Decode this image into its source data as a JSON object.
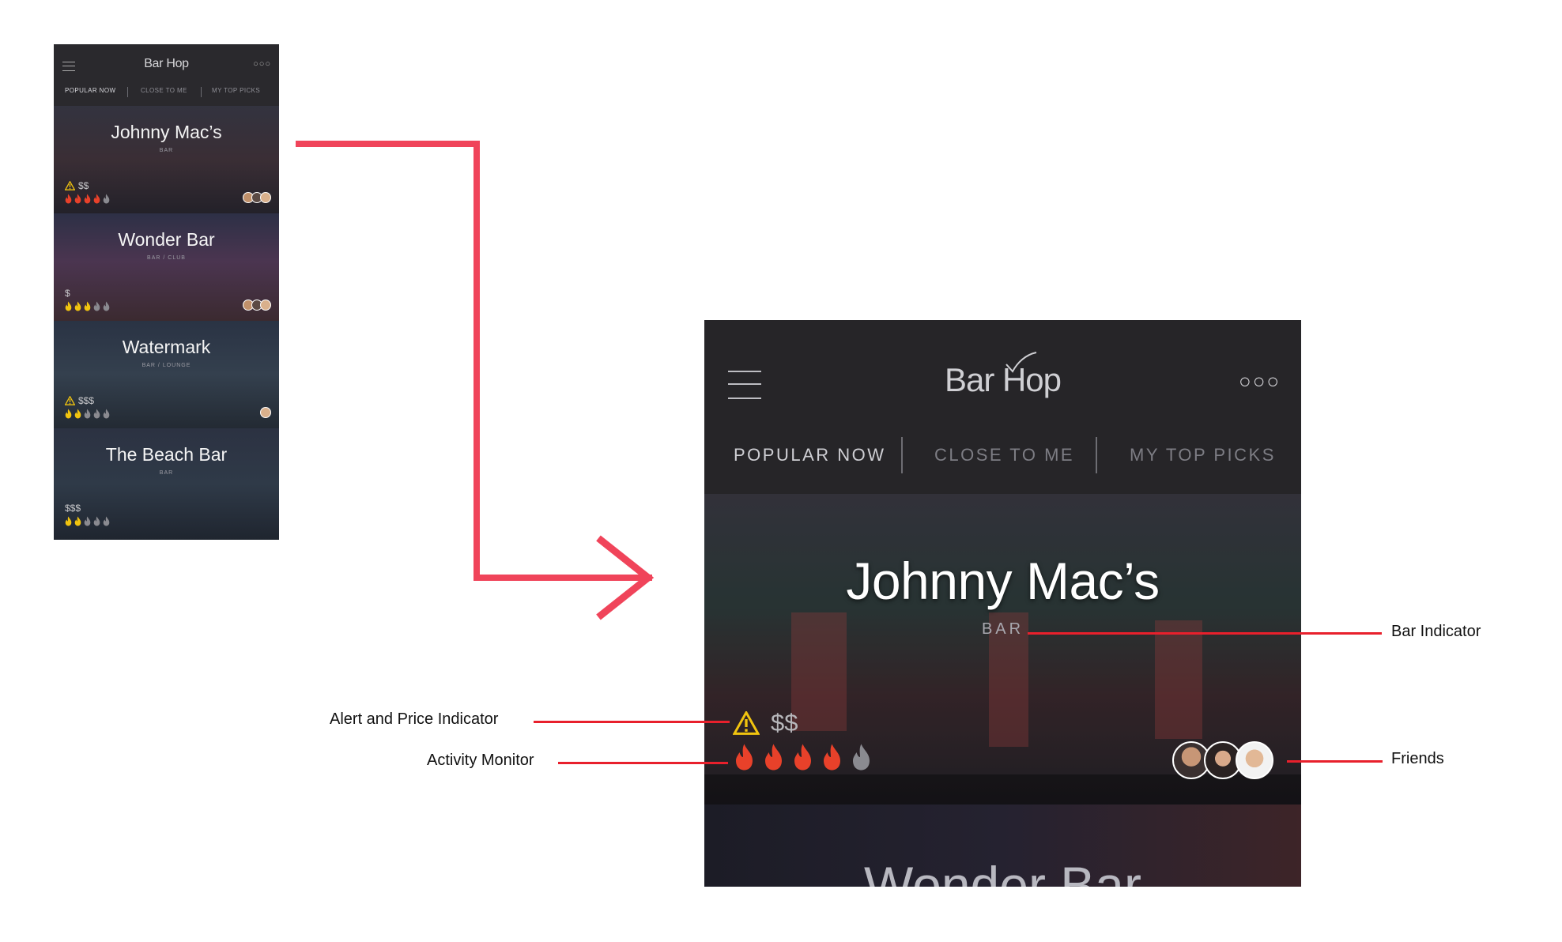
{
  "app": {
    "title": "Bar Hop",
    "more_icon": "more-dots-icon",
    "menu_icon": "hamburger-menu-icon"
  },
  "tabs": [
    {
      "label": "POPULAR NOW",
      "active": true
    },
    {
      "label": "CLOSE TO ME",
      "active": false
    },
    {
      "label": "MY TOP PICKS",
      "active": false
    }
  ],
  "venues": [
    {
      "name": "Johnny Mac’s",
      "type": "BAR",
      "alert": true,
      "price": "$$",
      "activity": 4,
      "friends": 3
    },
    {
      "name": "Wonder Bar",
      "type": "BAR / CLUB",
      "alert": false,
      "price": "$",
      "activity": 3,
      "friends": 3
    },
    {
      "name": "Watermark",
      "type": "BAR / LOUNGE",
      "alert": true,
      "price": "$$$",
      "activity": 2,
      "friends": 1
    },
    {
      "name": "The Beach Bar",
      "type": "BAR",
      "alert": false,
      "price": "$$$",
      "activity": 2,
      "friends": 0
    }
  ],
  "detail": {
    "name": "Johnny Mac’s",
    "type": "BAR",
    "price": "$$",
    "activity": 4,
    "activity_max": 5,
    "next_name": "Wonder Bar"
  },
  "annotations": {
    "bar_indicator": "Bar Indicator",
    "alert_price": "Alert and Price Indicator",
    "activity_monitor": "Activity Monitor",
    "friends": "Friends"
  },
  "colors": {
    "accent_red": "#e8202c",
    "fire_active": "#e8412a",
    "fire_inactive": "#8a8a90",
    "alert_yellow": "#f1c40f"
  }
}
